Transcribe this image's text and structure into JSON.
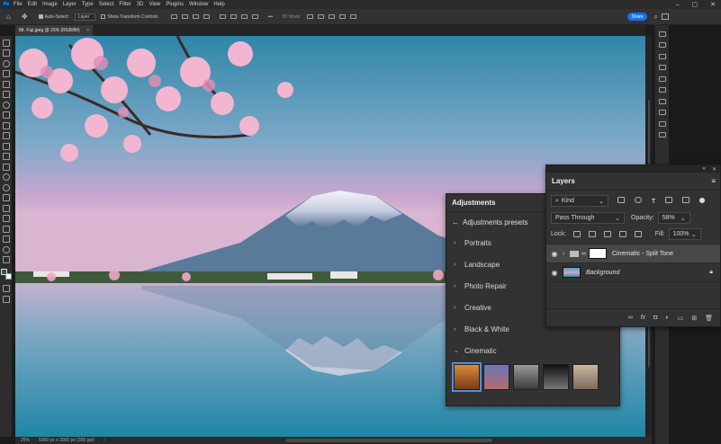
{
  "menu": {
    "items": [
      "File",
      "Edit",
      "Image",
      "Layer",
      "Type",
      "Select",
      "Filter",
      "3D",
      "View",
      "Plugins",
      "Window",
      "Help"
    ]
  },
  "options": {
    "auto_select": "Auto-Select:",
    "auto_select_value": "Layer",
    "transform_controls": "Show Transform Controls",
    "mode_3d": "3D Mode:",
    "more": "•••"
  },
  "share": "Share",
  "doc_tab": {
    "title": "Mt. Fuji.jpeg @ 25% (RGB/8#)",
    "close": "×"
  },
  "status": {
    "zoom": "25%",
    "dims": "5000 px x 3000 px (300 ppi)",
    "arrow": "›"
  },
  "adjustments": {
    "title": "Adjustments",
    "presets": "Adjustments presets",
    "categories": [
      "Portraits",
      "Landscape",
      "Photo Repair",
      "Creative",
      "Black & White"
    ],
    "expanded": "Cinematic",
    "thumb_count": 5
  },
  "layers": {
    "title": "Layers",
    "kind": "Kind",
    "blend": "Pass Through",
    "opacity_label": "Opacity:",
    "opacity_value": "58%",
    "lock_label": "Lock:",
    "fill_label": "Fill:",
    "fill_value": "100%",
    "rows": [
      {
        "name": "Cinematic - Split Tone",
        "selected": true
      },
      {
        "name": "Background",
        "selected": false
      }
    ],
    "fx": "fx"
  },
  "colors": {
    "accent": "#1473e6",
    "panel": "#323232",
    "canvas_sky": "#6a9fb5"
  }
}
